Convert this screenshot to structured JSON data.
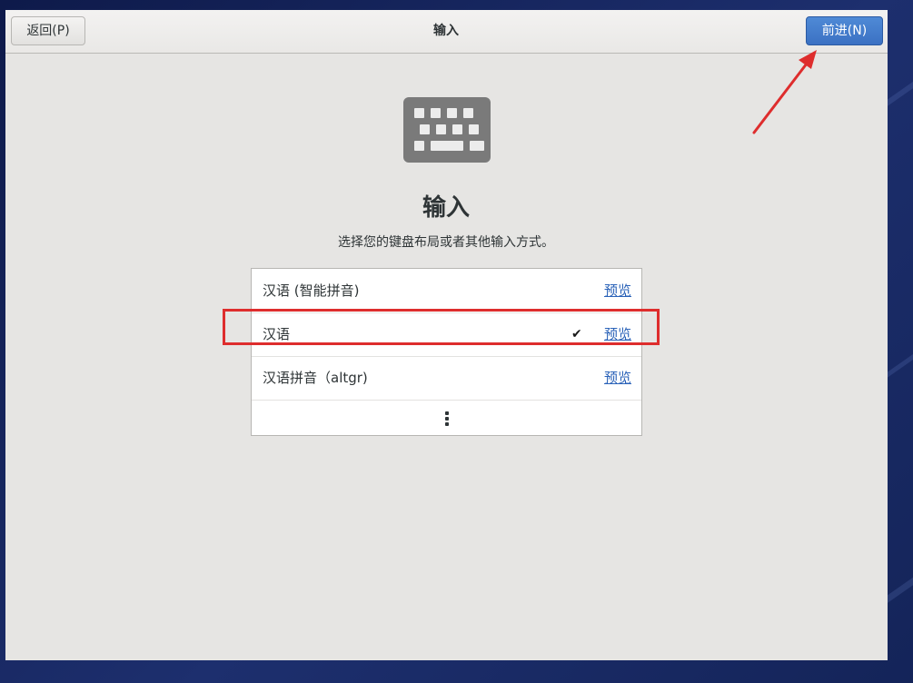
{
  "header": {
    "back_label": "返回(P)",
    "title": "输入",
    "next_label": "前进(N)"
  },
  "main": {
    "title": "输入",
    "subtitle": "选择您的键盘布局或者其他输入方式。"
  },
  "input_sources": [
    {
      "label": "汉语 (智能拼音)",
      "preview": "预览",
      "selected": false
    },
    {
      "label": "汉语",
      "preview": "预览",
      "selected": true,
      "check": "✔"
    },
    {
      "label": "汉语拼音（altgr)",
      "preview": "预览",
      "selected": false
    }
  ],
  "icons": {
    "header_icon": "keyboard-icon",
    "more": "more-vertical-icon",
    "selected": "checkmark-icon"
  },
  "colors": {
    "accent": "#3b71c3",
    "annotation": "#de2d2d",
    "window_bg": "#e6e5e3",
    "link": "#2a62b8"
  }
}
